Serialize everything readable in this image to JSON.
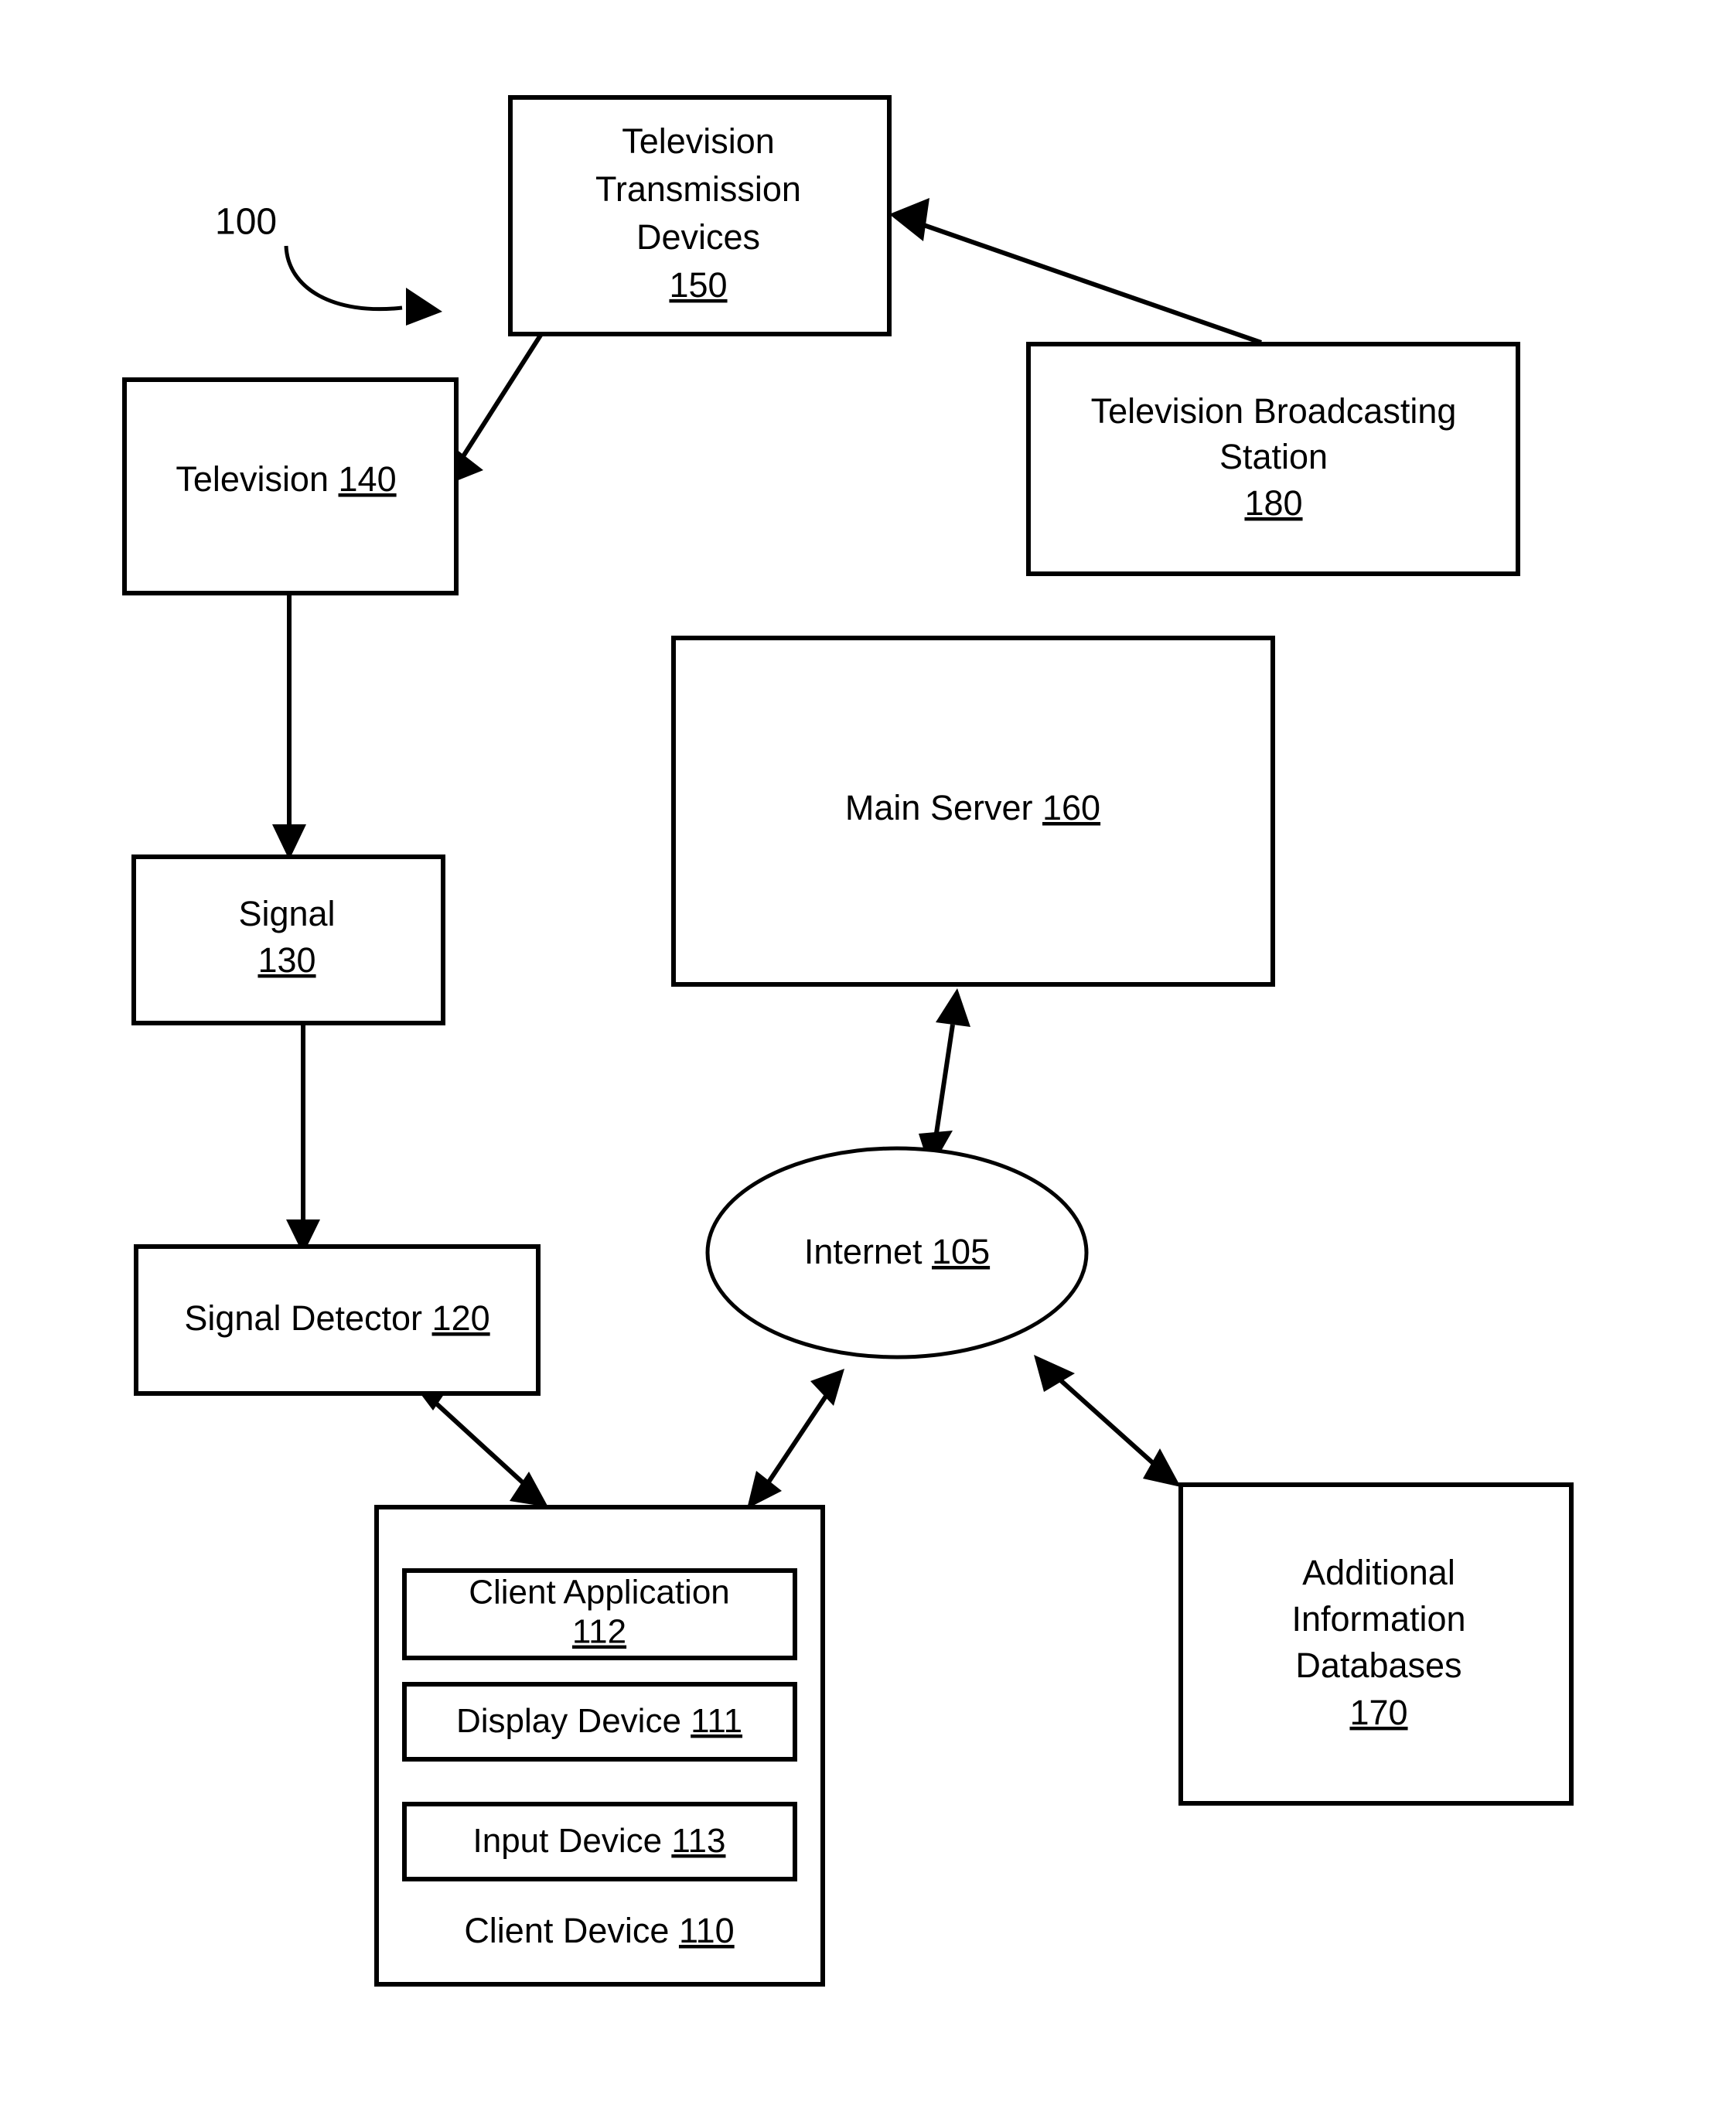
{
  "figure": {
    "reference_label": "100",
    "background_color": "#ffffff",
    "line_color": "#000000"
  },
  "nodes": {
    "tv_transmission_devices": {
      "line1": "Television",
      "line2": "Transmission",
      "line3": "Devices",
      "ref": "150"
    },
    "television": {
      "label": "Television",
      "ref": "140"
    },
    "signal": {
      "label": "Signal",
      "ref": "130"
    },
    "signal_detector": {
      "label": "Signal Detector",
      "ref": "120"
    },
    "tv_broadcasting_station": {
      "line1": "Television Broadcasting",
      "line2": "Station",
      "ref": "180"
    },
    "main_server": {
      "label": "Main Server",
      "ref": "160"
    },
    "internet": {
      "label": "Internet",
      "ref": "105"
    },
    "additional_info_databases": {
      "line1": "Additional",
      "line2": "Information",
      "line3": "Databases",
      "ref": "170"
    },
    "client_device": {
      "label": "Client Device",
      "ref": "110"
    },
    "client_application": {
      "label": "Client Application",
      "ref": "112"
    },
    "display_device": {
      "label": "Display Device",
      "ref": "111"
    },
    "input_device": {
      "label": "Input Device",
      "ref": "113"
    }
  }
}
